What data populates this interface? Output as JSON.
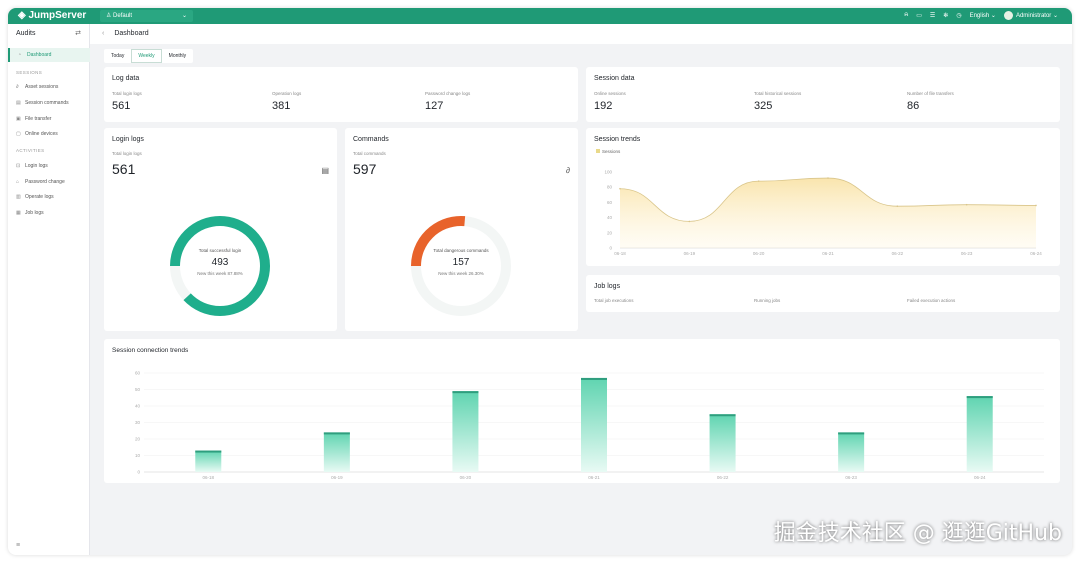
{
  "header": {
    "logo": "JumpServer",
    "org": "Default",
    "language": "English",
    "user": "Administrator"
  },
  "sidebar": {
    "title": "Audits",
    "items": [
      {
        "label": "Dashboard"
      },
      {
        "label": "Asset sessions"
      },
      {
        "label": "Session commands"
      },
      {
        "label": "File transfer"
      },
      {
        "label": "Online devices"
      },
      {
        "label": "Login logs"
      },
      {
        "label": "Password change"
      },
      {
        "label": "Operate logs"
      },
      {
        "label": "Job logs"
      }
    ],
    "groups": [
      "SESSIONS",
      "ACTIVITIES"
    ]
  },
  "breadcrumb": "Dashboard",
  "tabs": [
    "Today",
    "Weekly",
    "Monthly"
  ],
  "log_data": {
    "title": "Log data",
    "stats": [
      {
        "label": "Total login logs",
        "value": "561"
      },
      {
        "label": "Operation logs",
        "value": "381"
      },
      {
        "label": "Password change logs",
        "value": "127"
      }
    ]
  },
  "session_data": {
    "title": "Session data",
    "stats": [
      {
        "label": "Online sessions",
        "value": "192"
      },
      {
        "label": "Total historical sessions",
        "value": "325"
      },
      {
        "label": "Number of file transfers",
        "value": "86"
      }
    ]
  },
  "login_logs": {
    "title": "Login logs",
    "label": "Total login logs",
    "value": "561",
    "inner_label": "Total successful login",
    "inner_value": "493",
    "ratio": "New this week 87.88%",
    "percent": 87.88,
    "color": "#1fae8c"
  },
  "commands": {
    "title": "Commands",
    "label": "Total commands",
    "value": "597",
    "inner_label": "Total dangerous commands",
    "inner_value": "157",
    "ratio": "New this week 26.30%",
    "percent": 26.3,
    "color": "#e8632b"
  },
  "job_logs": {
    "title": "Job logs",
    "stats": [
      "Total job executions",
      "Running jobs",
      "Failed execution actions"
    ]
  },
  "chart_data": [
    {
      "type": "area",
      "title": "Session trends",
      "legend": [
        "Sessions"
      ],
      "x": [
        "06-18",
        "06-19",
        "06-20",
        "06-21",
        "06-22",
        "06-23",
        "06-24"
      ],
      "values": [
        78,
        35,
        88,
        92,
        55,
        57,
        56
      ],
      "ylim": [
        0,
        100
      ],
      "yticks": [
        0,
        20,
        40,
        60,
        80,
        100
      ],
      "color": "#e9c873"
    },
    {
      "type": "bar",
      "title": "Session connection trends",
      "x": [
        "06-18",
        "06-19",
        "06-20",
        "06-21",
        "06-22",
        "06-23",
        "06-24"
      ],
      "values": [
        13,
        24,
        49,
        57,
        35,
        24,
        46
      ],
      "ylim": [
        0,
        60
      ],
      "yticks": [
        0,
        10,
        20,
        30,
        40,
        50,
        60
      ],
      "color": "#3cc9a0"
    }
  ],
  "watermark": "掘金技术社区 @ 逛逛GitHub"
}
